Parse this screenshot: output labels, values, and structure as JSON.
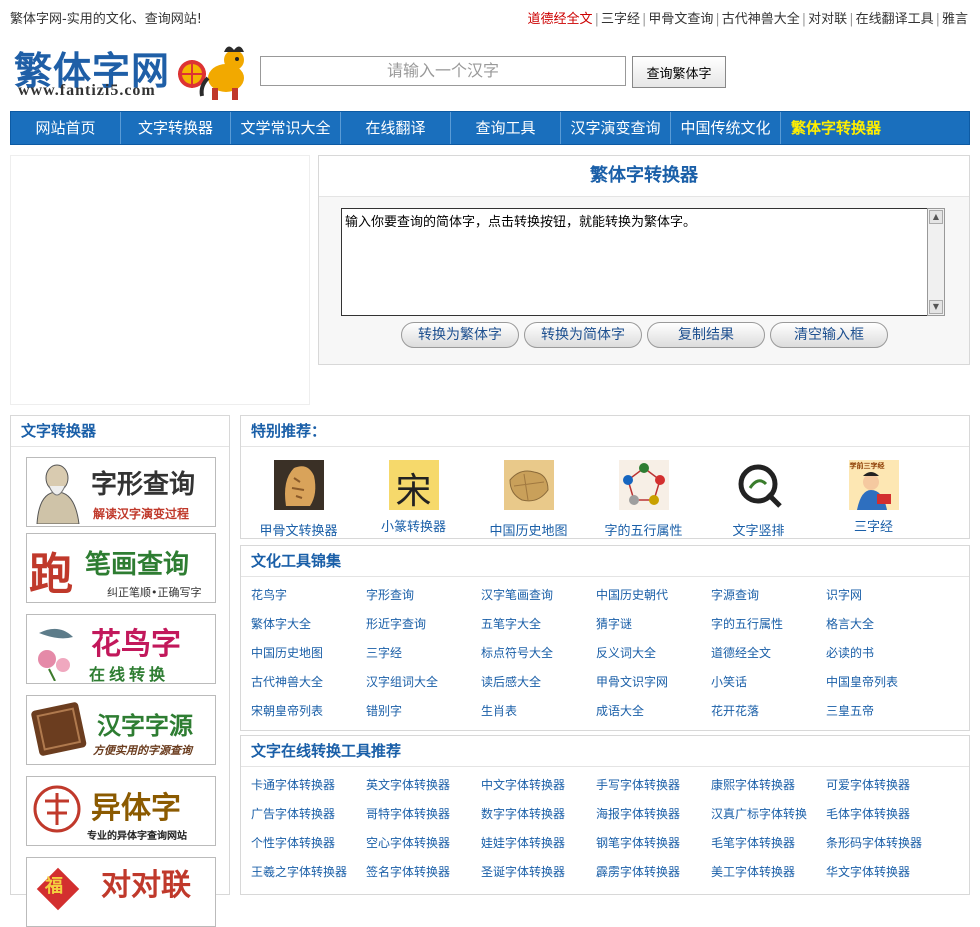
{
  "topbar": {
    "tagline": "繁体字网-实用的文化、查询网站!",
    "links": [
      "道德经全文",
      "三字经",
      "甲骨文查询",
      "古代神兽大全",
      "对对联",
      "在线翻译工具",
      "雅言"
    ],
    "separator": "|",
    "highlight_color": "#cc0000"
  },
  "header": {
    "logo_text": "繁体字网",
    "logo_url": "www.fantizi5.com",
    "search_placeholder": "请输入一个汉字",
    "search_button": "查询繁体字"
  },
  "nav": {
    "items": [
      "网站首页",
      "文字转换器",
      "文学常识大全",
      "在线翻译",
      "查询工具",
      "汉字演变查询",
      "中国传统文化",
      "繁体字转换器"
    ],
    "active_index": 7,
    "bg_color": "#1a6fbd",
    "active_color": "#ffee00"
  },
  "converter": {
    "title": "繁体字转换器",
    "textarea_value": "输入你要查询的简体字，点击转换按钮，就能转换为繁体字。",
    "buttons": [
      "转换为繁体字",
      "转换为简体字",
      "复制结果",
      "清空输入框"
    ]
  },
  "sidebar": {
    "title": "文字转换器",
    "banners": [
      {
        "title": "字形查询",
        "subtitle": "解读汉字演变过程"
      },
      {
        "title": "笔画查询",
        "big_char": "跑",
        "subtitle": "纠正笔顺•正确写字"
      },
      {
        "title": "花鸟字",
        "subtitle": "在线转换"
      },
      {
        "title": "汉字字源",
        "subtitle": "方便实用的字源查询"
      },
      {
        "title": "异体字",
        "subtitle": "专业的异体字查询网站"
      },
      {
        "title": "对对联",
        "big_char": "福"
      }
    ]
  },
  "featured": {
    "title": "特别推荐：",
    "items": [
      {
        "label": "甲骨文转换器",
        "icon": "oracle-bone-icon"
      },
      {
        "label": "小篆转换器",
        "icon": "seal-script-icon",
        "glyph": "宋"
      },
      {
        "label": "中国历史地图",
        "icon": "history-map-icon"
      },
      {
        "label": "字的五行属性",
        "icon": "five-elements-icon"
      },
      {
        "label": "文字竖排",
        "icon": "vertical-text-icon"
      },
      {
        "label": "三字经",
        "icon": "three-char-classic-icon",
        "glyph": "学前三字经"
      }
    ]
  },
  "tools": {
    "title": "文化工具锦集",
    "links": [
      [
        "花鸟字",
        "字形查询",
        "汉字笔画查询",
        "中国历史朝代",
        "字源查询",
        "识字网"
      ],
      [
        "繁体字大全",
        "形近字查询",
        "五笔字大全",
        "猜字谜",
        "字的五行属性",
        "格言大全"
      ],
      [
        "中国历史地图",
        "三字经",
        "标点符号大全",
        "反义词大全",
        "道德经全文",
        "必读的书"
      ],
      [
        "古代神兽大全",
        "汉字组词大全",
        "读后感大全",
        "甲骨文识字网",
        "小笑话",
        "中国皇帝列表"
      ],
      [
        "宋朝皇帝列表",
        "错别字",
        "生肖表",
        "成语大全",
        "花开花落",
        "三皇五帝"
      ]
    ]
  },
  "fonttools": {
    "title": "文字在线转换工具推荐",
    "links": [
      [
        "卡通字体转换器",
        "英文字体转换器",
        "中文字体转换器",
        "手写字体转换器",
        "康熙字体转换器",
        "可爱字体转换器"
      ],
      [
        "广告字体转换器",
        "哥特字体转换器",
        "数字字体转换器",
        "海报字体转换器",
        "汉真广标字体转换",
        "毛体字体转换器"
      ],
      [
        "个性字体转换器",
        "空心字体转换器",
        "娃娃字体转换器",
        "钢笔字体转换器",
        "毛笔字体转换器",
        "条形码字体转换器"
      ],
      [
        "王羲之字体转换器",
        "签名字体转换器",
        "圣诞字体转换器",
        "霹雳字体转换器",
        "美工字体转换器",
        "华文字体转换器"
      ]
    ]
  }
}
